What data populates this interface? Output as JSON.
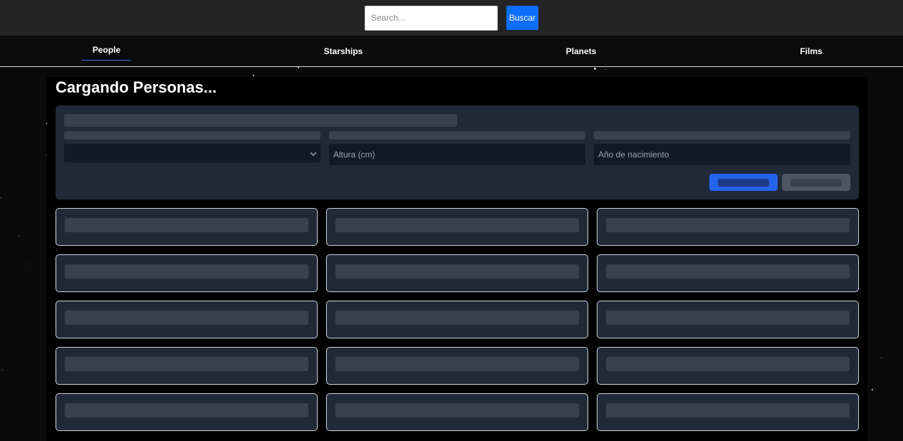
{
  "search": {
    "placeholder": "Search...",
    "button_label": "Buscar"
  },
  "nav": {
    "tabs": [
      {
        "label": "People",
        "active": true
      },
      {
        "label": "Starships",
        "active": false
      },
      {
        "label": "Planets",
        "active": false
      },
      {
        "label": "Films",
        "active": false
      }
    ]
  },
  "main": {
    "title": "Cargando Personas...",
    "filters": {
      "height_placeholder": "Altura (cm)",
      "birth_year_placeholder": "Año de nacimiento"
    },
    "card_count": 15
  },
  "colors": {
    "accent": "#0d6efd",
    "panel": "#1f2937",
    "skeleton": "#374151"
  }
}
